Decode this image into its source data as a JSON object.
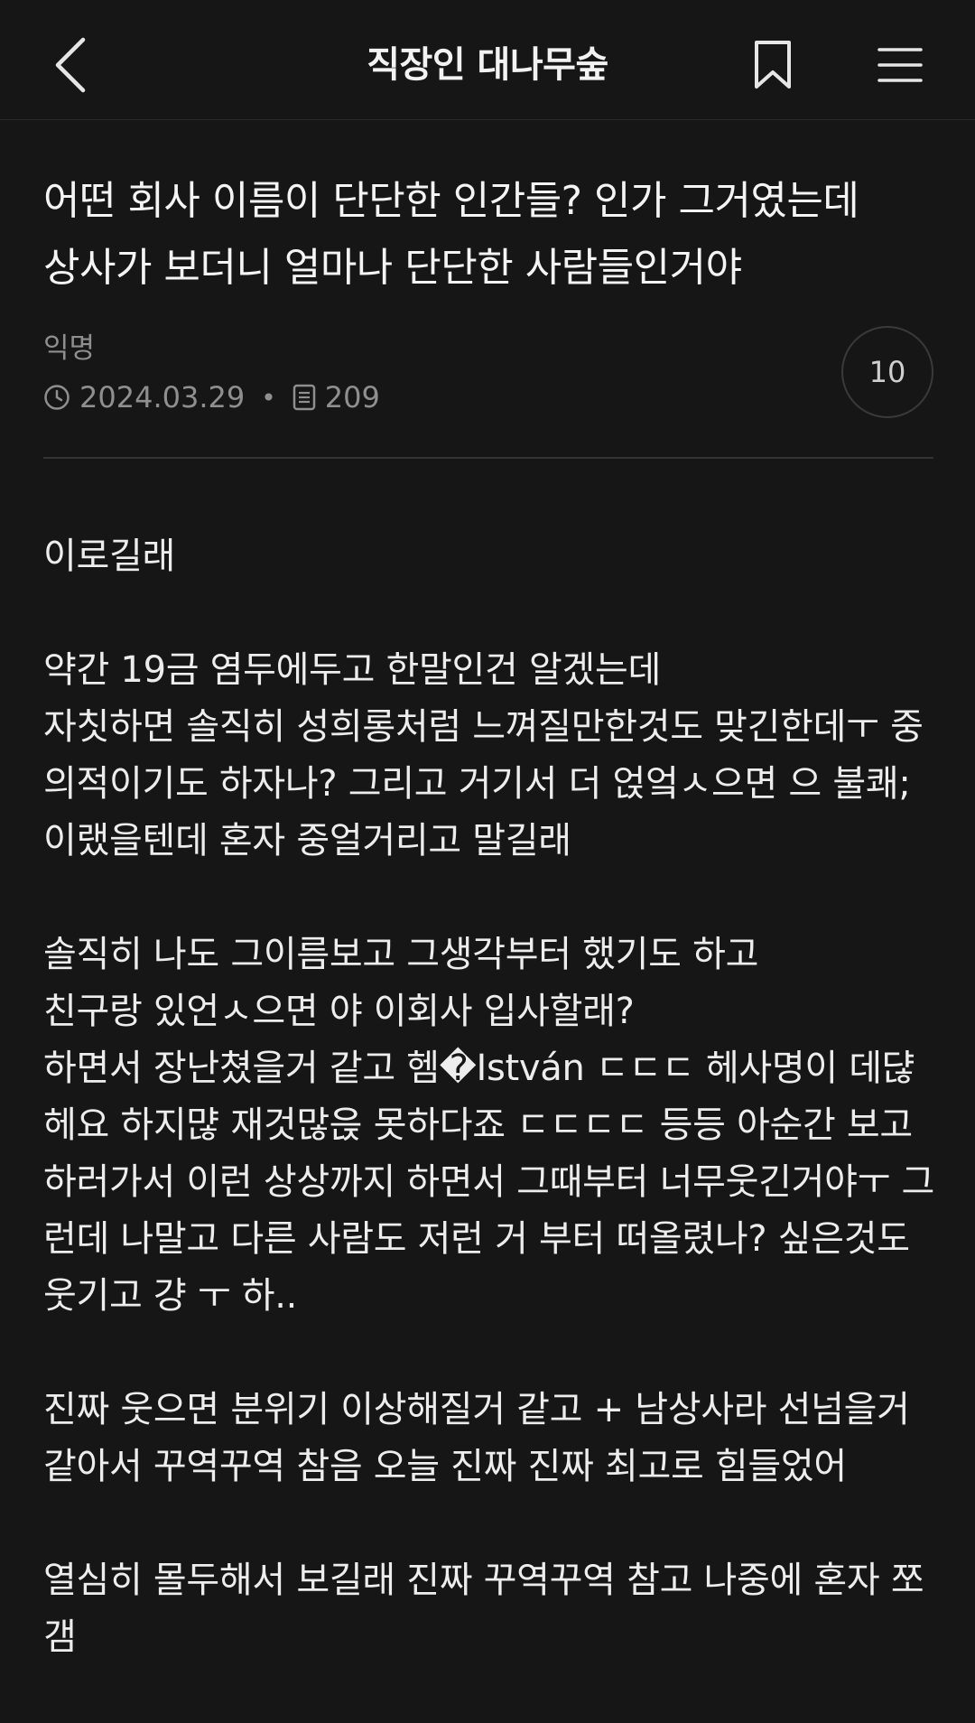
{
  "header": {
    "title": "직장인 대나무숲",
    "back_icon": "chevron-left-icon",
    "bookmark_icon": "bookmark-icon",
    "menu_icon": "hamburger-menu-icon"
  },
  "post": {
    "title": "어떤 회사 이름이 단단한 인간들? 인가 그거였는데 상사가 보더니 얼마나 단단한 사람들인거야",
    "author": "익명",
    "date": "2024.03.29",
    "views": "209",
    "comment_count": "10",
    "paragraphs": [
      "이로길래",
      "약간 19금 염두에두고 한말인건 알겠는데\n자칫하면 솔직히 성희롱처럼 느껴질만한것도 맞긴한데ㅜ 중의적이기도 하자나? 그리고 거기서 더 얹엌ㅅ으면 으 불쾌;\n이랬을텐데 혼자 중얼거리고 말길래",
      "솔직히 나도 그이름보고 그생각부터 했기도 하고\n친구랑 있언ㅅ으면 야 이회사 입사할래?\n하면서 장난쳤을거 같고 헴�István ㄷㄷㄷ 헤사명이 데댢헤요 하지먆 재것많읁 못하다죠 ㄷㄷㄷㄷ 등등 아순간 보고하러가서 이런 상상까지 하면서 그때부터 너무웃긴거야ㅜ 그런데 나말고 다른 사람도 저런 거 부터 떠올렸나? 싶은것도 웃기고 걍 ㅜ 하..",
      "진짜 웃으면 분위기 이상해질거 같고 + 남상사라 선넘을거 같아서 꾸역꾸역 참음 오늘 진짜 진짜 최고로 힘들었어",
      "열심히 몰두해서 보길래 진짜 꾸역꾸역 참고 나중에 혼자 쪼갬"
    ]
  },
  "colors": {
    "background": "#161616",
    "text": "#ededed",
    "muted": "#8f8f8f",
    "divider": "#333333"
  }
}
